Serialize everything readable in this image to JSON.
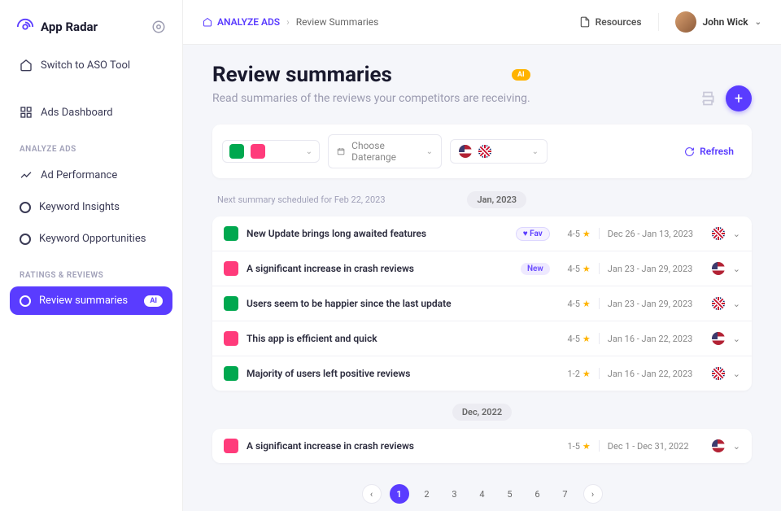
{
  "brand": {
    "name": "App Radar"
  },
  "sidebar": {
    "switch_tool": "Switch to ASO Tool",
    "dashboard": "Ads Dashboard",
    "section1": "ANALYZE ADS",
    "ad_performance": "Ad Performance",
    "keyword_insights": "Keyword Insights",
    "keyword_opportunities": "Keyword Opportunities",
    "section2": "RATINGS & REVIEWS",
    "review_summaries": "Review summaries",
    "ai_badge": "AI"
  },
  "topbar": {
    "bc_root": "ANALYZE ADS",
    "bc_current": "Review Summaries",
    "resources": "Resources",
    "user_name": "John Wick"
  },
  "page": {
    "title": "Review summaries",
    "ai_badge": "AI",
    "subtitle": "Read summaries of the reviews your competitors are receiving."
  },
  "filters": {
    "date_placeholder": "Choose Daterange",
    "refresh": "Refresh"
  },
  "schedule_note": "Next summary scheduled for Feb 22, 2023",
  "month1": "Jan, 2023",
  "month2": "Dec, 2022",
  "rows1": [
    {
      "app": "g",
      "title": "New Update brings long awaited features",
      "badge": "fav",
      "badge_label": "Fav",
      "rating": "4-5",
      "dates": "Dec 26 - Jan 13, 2023",
      "flag": "uk"
    },
    {
      "app": "p",
      "title": "A significant increase in crash reviews",
      "badge": "new",
      "badge_label": "New",
      "rating": "4-5",
      "dates": "Jan 23 - Jan 29, 2023",
      "flag": "us"
    },
    {
      "app": "g",
      "title": "Users seem to be happier since the last update",
      "badge": "",
      "badge_label": "",
      "rating": "4-5",
      "dates": "Jan 23 - Jan 29, 2023",
      "flag": "uk"
    },
    {
      "app": "p",
      "title": "This app is efficient and quick",
      "badge": "",
      "badge_label": "",
      "rating": "4-5",
      "dates": "Jan 16 - Jan 22, 2023",
      "flag": "us"
    },
    {
      "app": "g",
      "title": "Majority of users left positive reviews",
      "badge": "",
      "badge_label": "",
      "rating": "1-2",
      "dates": "Jan 16 - Jan 22, 2023",
      "flag": "uk"
    }
  ],
  "rows2": [
    {
      "app": "p",
      "title": "A significant increase in crash reviews",
      "badge": "",
      "badge_label": "",
      "rating": "1-5",
      "dates": "Dec 1 - Dec  31, 2022",
      "flag": "us"
    }
  ],
  "pagination": {
    "pages": [
      "1",
      "2",
      "3",
      "4",
      "5",
      "6",
      "7"
    ],
    "active": "1"
  }
}
